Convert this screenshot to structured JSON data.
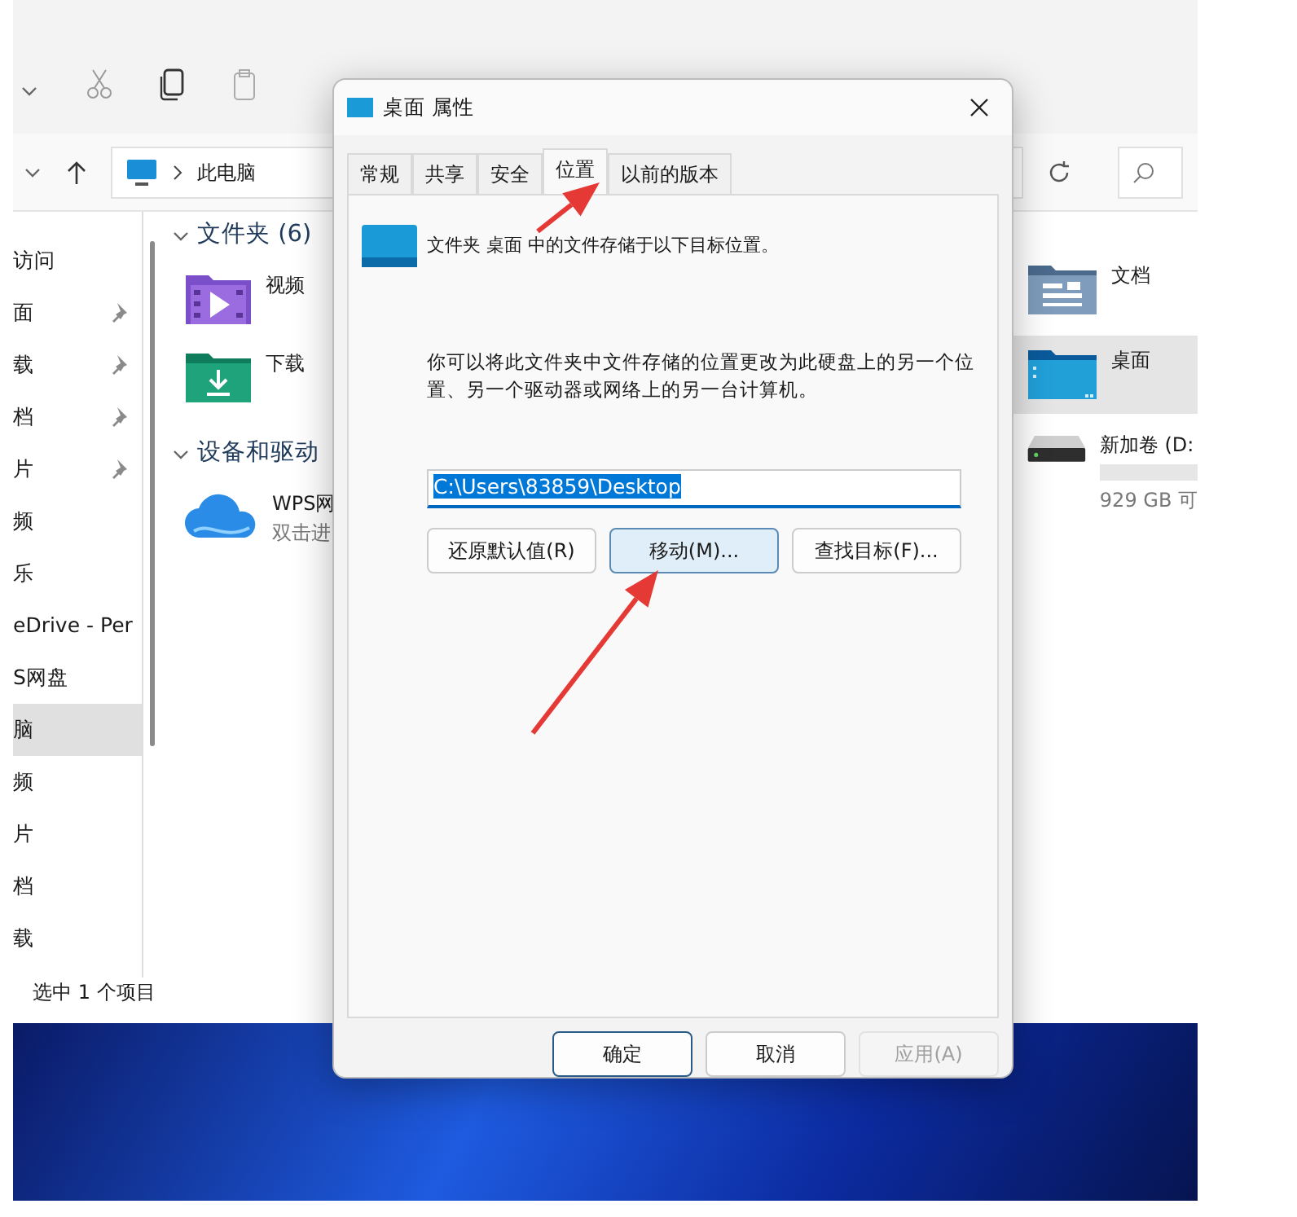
{
  "explorer": {
    "address": {
      "location": "此电脑"
    },
    "sidebar": {
      "items": [
        {
          "label": "访问",
          "pinned": false,
          "selected": false
        },
        {
          "label": "面",
          "pinned": true,
          "selected": false
        },
        {
          "label": "载",
          "pinned": true,
          "selected": false
        },
        {
          "label": "档",
          "pinned": true,
          "selected": false
        },
        {
          "label": "片",
          "pinned": true,
          "selected": false
        },
        {
          "label": "频",
          "pinned": false,
          "selected": false
        },
        {
          "label": "乐",
          "pinned": false,
          "selected": false
        },
        {
          "label": "eDrive - Per",
          "pinned": false,
          "selected": false
        },
        {
          "label": "S网盘",
          "pinned": false,
          "selected": false
        },
        {
          "label": "脑",
          "pinned": false,
          "selected": true
        },
        {
          "label": "频",
          "pinned": false,
          "selected": false
        },
        {
          "label": "片",
          "pinned": false,
          "selected": false
        },
        {
          "label": "档",
          "pinned": false,
          "selected": false
        },
        {
          "label": "载",
          "pinned": false,
          "selected": false
        }
      ]
    },
    "sections": [
      {
        "title": "文件夹 (6)",
        "items": [
          {
            "kind": "videos",
            "label": "视频",
            "selected": false
          },
          {
            "kind": "downloads",
            "label": "下载",
            "selected": false
          }
        ]
      },
      {
        "title": "设备和驱动",
        "items": [
          {
            "kind": "cloud",
            "label": "WPS网",
            "detail": "双击进",
            "selected": false
          }
        ]
      }
    ],
    "right_items": [
      {
        "kind": "documents",
        "label": "文档",
        "selected": false
      },
      {
        "kind": "desktop",
        "label": "桌面",
        "selected": true
      },
      {
        "kind": "drive",
        "label": "新加卷 (D:",
        "level": 0,
        "detail": "929 GB 可",
        "selected": false
      }
    ],
    "status_bar": "选中 1 个项目"
  },
  "dialog": {
    "title": "桌面 属性",
    "tabs": [
      {
        "label": "常规",
        "selected": false
      },
      {
        "label": "共享",
        "selected": false
      },
      {
        "label": "安全",
        "selected": false
      },
      {
        "label": "位置",
        "selected": true
      },
      {
        "label": "以前的版本",
        "selected": false
      }
    ],
    "heading": "文件夹 桌面 中的文件存储于以下目标位置。",
    "description": "你可以将此文件夹中文件存储的位置更改为此硬盘上的另一个位置、另一个驱动器或网络上的另一台计算机。",
    "path": {
      "value": "C:\\Users\\83859\\Desktop",
      "text_selected": true
    },
    "actions": [
      {
        "label": "还原默认值(R)",
        "highlighted": false
      },
      {
        "label": "移动(M)...",
        "highlighted": true
      },
      {
        "label": "查找目标(F)...",
        "highlighted": false
      }
    ],
    "footer_buttons": [
      {
        "label": "确定",
        "default": true,
        "disabled": false
      },
      {
        "label": "取消",
        "default": false,
        "disabled": false
      },
      {
        "label": "应用(A)",
        "default": false,
        "disabled": true
      }
    ]
  }
}
